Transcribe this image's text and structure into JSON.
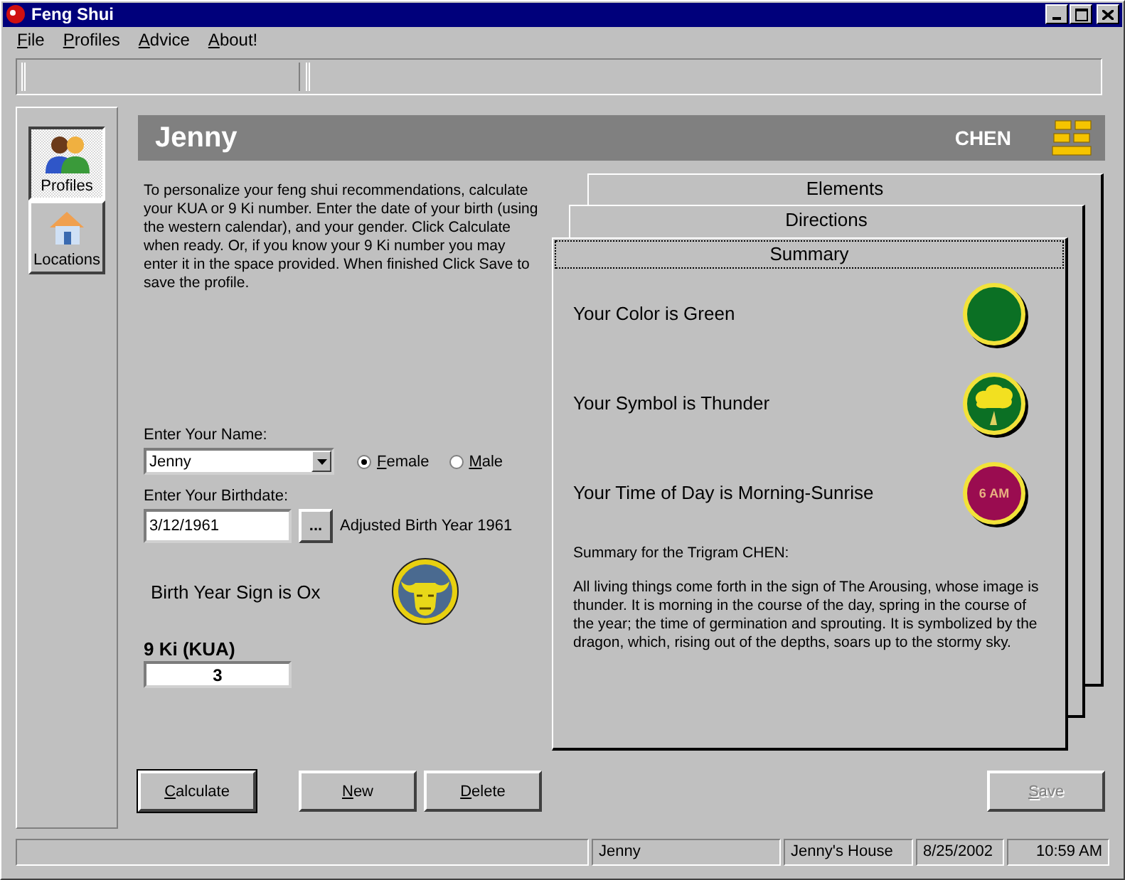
{
  "window": {
    "title": "Feng Shui"
  },
  "menu": [
    {
      "label": "File"
    },
    {
      "label": "Profiles"
    },
    {
      "label": "Advice"
    },
    {
      "label": "About!"
    }
  ],
  "sidebar": {
    "items": [
      {
        "label": "Profiles",
        "kind": "people",
        "selected": true
      },
      {
        "label": "Locations",
        "kind": "house",
        "selected": false
      }
    ]
  },
  "header": {
    "name": "Jenny",
    "trigram": "CHEN"
  },
  "intro": "To personalize your feng shui recommendations, calculate your KUA or 9 Ki number.  Enter the date of your birth (using the western calendar), and your gender.  Click Calculate when ready.   Or, if you know your 9 Ki number you may enter it in the space provided.  When finished Click Save to save the profile.",
  "form": {
    "name_label": "Enter Your Name:",
    "name_value": "Jenny",
    "genders": [
      {
        "label": "Female",
        "selected": true
      },
      {
        "label": "Male",
        "selected": false
      }
    ],
    "birthdate_label": "Enter Your Birthdate:",
    "birthdate_value": "3/12/1961",
    "browse_button": "...",
    "adjusted_year": "Adjusted Birth Year 1961",
    "sign": "Birth Year Sign is Ox",
    "ki_label": "9 Ki (KUA)",
    "ki_value": "3"
  },
  "tabs": [
    {
      "label": "Elements",
      "selected": false
    },
    {
      "label": "Directions",
      "selected": false
    },
    {
      "label": "Summary",
      "selected": true
    }
  ],
  "summary": {
    "rows": [
      {
        "kind": "color",
        "text": "Your Color is Green",
        "color": "#0b7024"
      },
      {
        "kind": "symbol",
        "text": "Your Symbol is Thunder",
        "color": "#0b7024"
      },
      {
        "kind": "time",
        "text": "Your Time of Day is Morning-Sunrise",
        "color": "#9a0c50",
        "badge": "6 AM"
      }
    ],
    "heading": "Summary for the Trigram CHEN:",
    "body": "All living things come forth in the sign of The Arousing, whose image is thunder. It is morning in the course of the day, spring in the course of the year; the time of germination and sprouting. It is symbolized by the dragon, which, rising out of the depths, soars up to the stormy sky."
  },
  "buttons": [
    {
      "label": "Calculate",
      "kind": "default",
      "disabled": false
    },
    {
      "label": "New",
      "kind": "normal",
      "disabled": false
    },
    {
      "label": "Delete",
      "kind": "normal",
      "disabled": false
    },
    {
      "label": "Save",
      "kind": "right",
      "disabled": true
    }
  ],
  "status_bar": [
    "Jenny",
    "Jenny's House",
    "8/25/2002",
    "10:59 AM"
  ]
}
